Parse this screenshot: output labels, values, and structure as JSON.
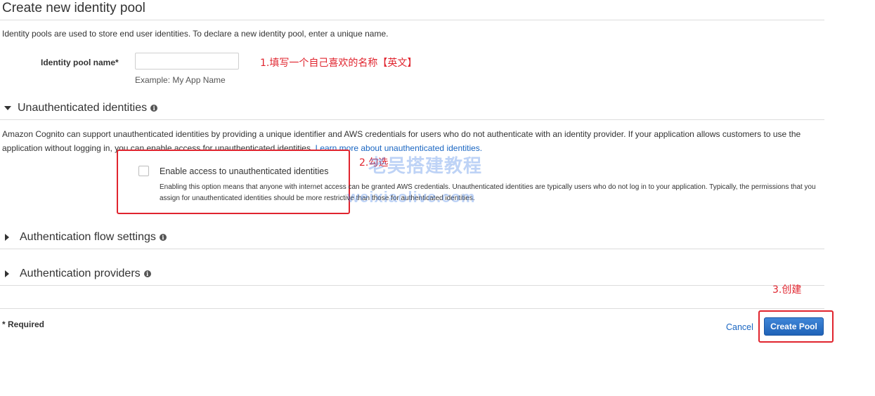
{
  "page": {
    "title": "Create new identity pool",
    "intro": "Identity pools are used to store end user identities. To declare a new identity pool, enter a unique name."
  },
  "pool_name": {
    "label": "Identity pool name*",
    "value": "",
    "placeholder": "",
    "hint": "Example: My App Name"
  },
  "annotations": {
    "step1": "1.填写一个自己喜欢的名称【英文】",
    "step2": "2.勾选",
    "step3": "3.创建"
  },
  "unauth": {
    "heading": "Unauthenticated identities",
    "description_part1": "Amazon Cognito can support unauthenticated identities by providing a unique identifier and AWS credentials for users who do not authenticate with an identity provider. If your application allows customers to use the application without logging in, you can enable access for unauthenticated identities.",
    "learn_more": "Learn more about unauthenticated identities.",
    "checkbox_label": "Enable access to unauthenticated identities",
    "checkbox_checked": false,
    "checkbox_desc": "Enabling this option means that anyone with internet access can be granted AWS credentials. Unauthenticated identities are typically users who do not log in to your application. Typically, the permissions that you assign for unauthenticated identities should be more restrictive than those for authenticated identities."
  },
  "sections": {
    "auth_flow": "Authentication flow settings",
    "auth_providers": "Authentication providers"
  },
  "watermark": {
    "text": "老吴搭建教程",
    "url": "weixiaolive.com"
  },
  "footer": {
    "required": "* Required",
    "cancel": "Cancel",
    "create": "Create Pool"
  },
  "colors": {
    "annotation_red": "#e0242e",
    "link_blue": "#1a66c2",
    "primary_button": "#1f63b8"
  },
  "icons": {
    "info": "info-icon",
    "expanded": "caret-down-icon",
    "collapsed": "caret-right-icon"
  }
}
